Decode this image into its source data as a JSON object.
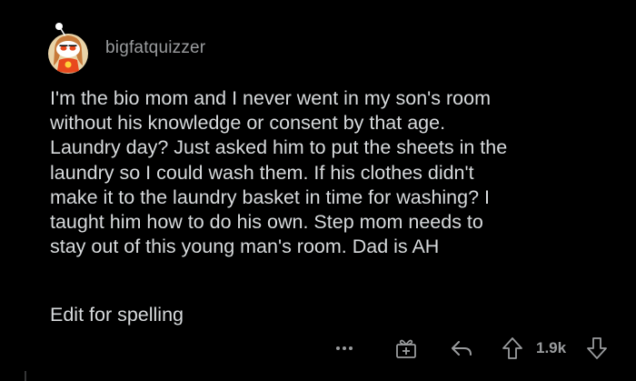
{
  "comment": {
    "username": "bigfatquizzer",
    "body": "I'm the bio mom and I never went in my son's room\nwithout his knowledge or consent by that age.\nLaundry day? Just asked him to put the sheets in the\nlaundry so I could wash them. If his clothes didn't\nmake it to the laundry basket in time for washing? I\ntaught him how to do his own. Step mom needs to\nstay out of this young man's room. Dad is AH",
    "edit_note": "Edit for spelling",
    "score": "1.9k"
  },
  "icons": {
    "avatar": "snoo-avatar-icon",
    "more": "more-options-icon",
    "award": "award-icon",
    "reply": "reply-icon",
    "upvote": "upvote-icon",
    "downvote": "downvote-icon"
  },
  "colors": {
    "background": "#000000",
    "text": "#d7dadc",
    "muted": "#9a9c9e",
    "avatar_bg": "#e8d3a8",
    "avatar_shirt": "#e8491d"
  }
}
